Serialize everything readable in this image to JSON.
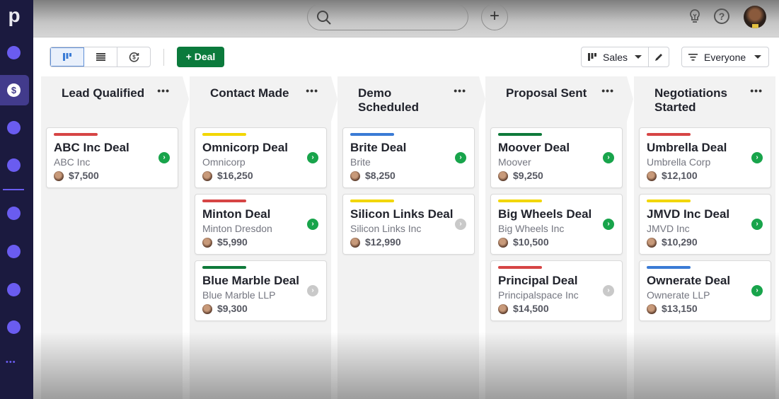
{
  "sidebar": {
    "logo": "p",
    "items": [
      {
        "name": "nav-item-1"
      },
      {
        "name": "deals",
        "active": true,
        "icon": "$"
      },
      {
        "name": "nav-item-3"
      },
      {
        "name": "nav-item-4"
      },
      {
        "name": "nav-item-5"
      },
      {
        "name": "nav-item-6"
      },
      {
        "name": "nav-item-7"
      },
      {
        "name": "nav-item-8"
      }
    ],
    "more": "•••"
  },
  "topbar": {
    "search_placeholder": "",
    "add_label": "+",
    "help_label": "?"
  },
  "toolbar": {
    "views": [
      "pipeline-view",
      "list-view",
      "forecast-view"
    ],
    "active_view": "pipeline-view",
    "add_deal_label": "+ Deal",
    "pipeline_label": "Sales",
    "owner_label": "Everyone"
  },
  "colors": {
    "accent_green": "#0b7a3c",
    "sidebar_bg": "#1b1a3f",
    "nav_dot": "#6a5cf0",
    "tag_red": "#d64545",
    "tag_yellow": "#f2d600",
    "tag_green": "#0e7a3a",
    "tag_blue": "#3a7bd5",
    "go_active": "#18a44b",
    "go_inactive": "#c9c9c9"
  },
  "stages": [
    {
      "title": "Lead Qualified",
      "menu": "•••",
      "deals": [
        {
          "title": "ABC Inc Deal",
          "org": "ABC Inc",
          "value": "$7,500",
          "tag": "red",
          "active": true
        }
      ]
    },
    {
      "title": "Contact Made",
      "menu": "•••",
      "deals": [
        {
          "title": "Omnicorp Deal",
          "org": "Omnicorp",
          "value": "$16,250",
          "tag": "yellow",
          "active": true
        },
        {
          "title": "Minton Deal",
          "org": "Minton Dresdon",
          "value": "$5,990",
          "tag": "red",
          "active": true
        },
        {
          "title": "Blue Marble Deal",
          "org": "Blue Marble LLP",
          "value": "$9,300",
          "tag": "green",
          "active": false
        }
      ]
    },
    {
      "title": "Demo Scheduled",
      "menu": "•••",
      "deals": [
        {
          "title": "Brite Deal",
          "org": "Brite",
          "value": "$8,250",
          "tag": "blue",
          "active": true
        },
        {
          "title": "Silicon Links Deal",
          "org": "Silicon Links Inc",
          "value": "$12,990",
          "tag": "yellow",
          "active": false
        }
      ]
    },
    {
      "title": "Proposal Sent",
      "menu": "•••",
      "deals": [
        {
          "title": "Moover Deal",
          "org": "Moover",
          "value": "$9,250",
          "tag": "green",
          "active": true
        },
        {
          "title": "Big Wheels Deal",
          "org": "Big Wheels Inc",
          "value": "$10,500",
          "tag": "yellow",
          "active": true
        },
        {
          "title": "Principal Deal",
          "org": "Principalspace Inc",
          "value": "$14,500",
          "tag": "red",
          "active": false
        }
      ]
    },
    {
      "title": "Negotiations Started",
      "menu": "•••",
      "deals": [
        {
          "title": "Umbrella Deal",
          "org": "Umbrella Corp",
          "value": "$12,100",
          "tag": "red",
          "active": true
        },
        {
          "title": "JMVD Inc Deal",
          "org": "JMVD Inc",
          "value": "$10,290",
          "tag": "yellow",
          "active": true
        },
        {
          "title": "Ownerate Deal",
          "org": "Ownerate LLP",
          "value": "$13,150",
          "tag": "blue",
          "active": true
        }
      ]
    }
  ]
}
